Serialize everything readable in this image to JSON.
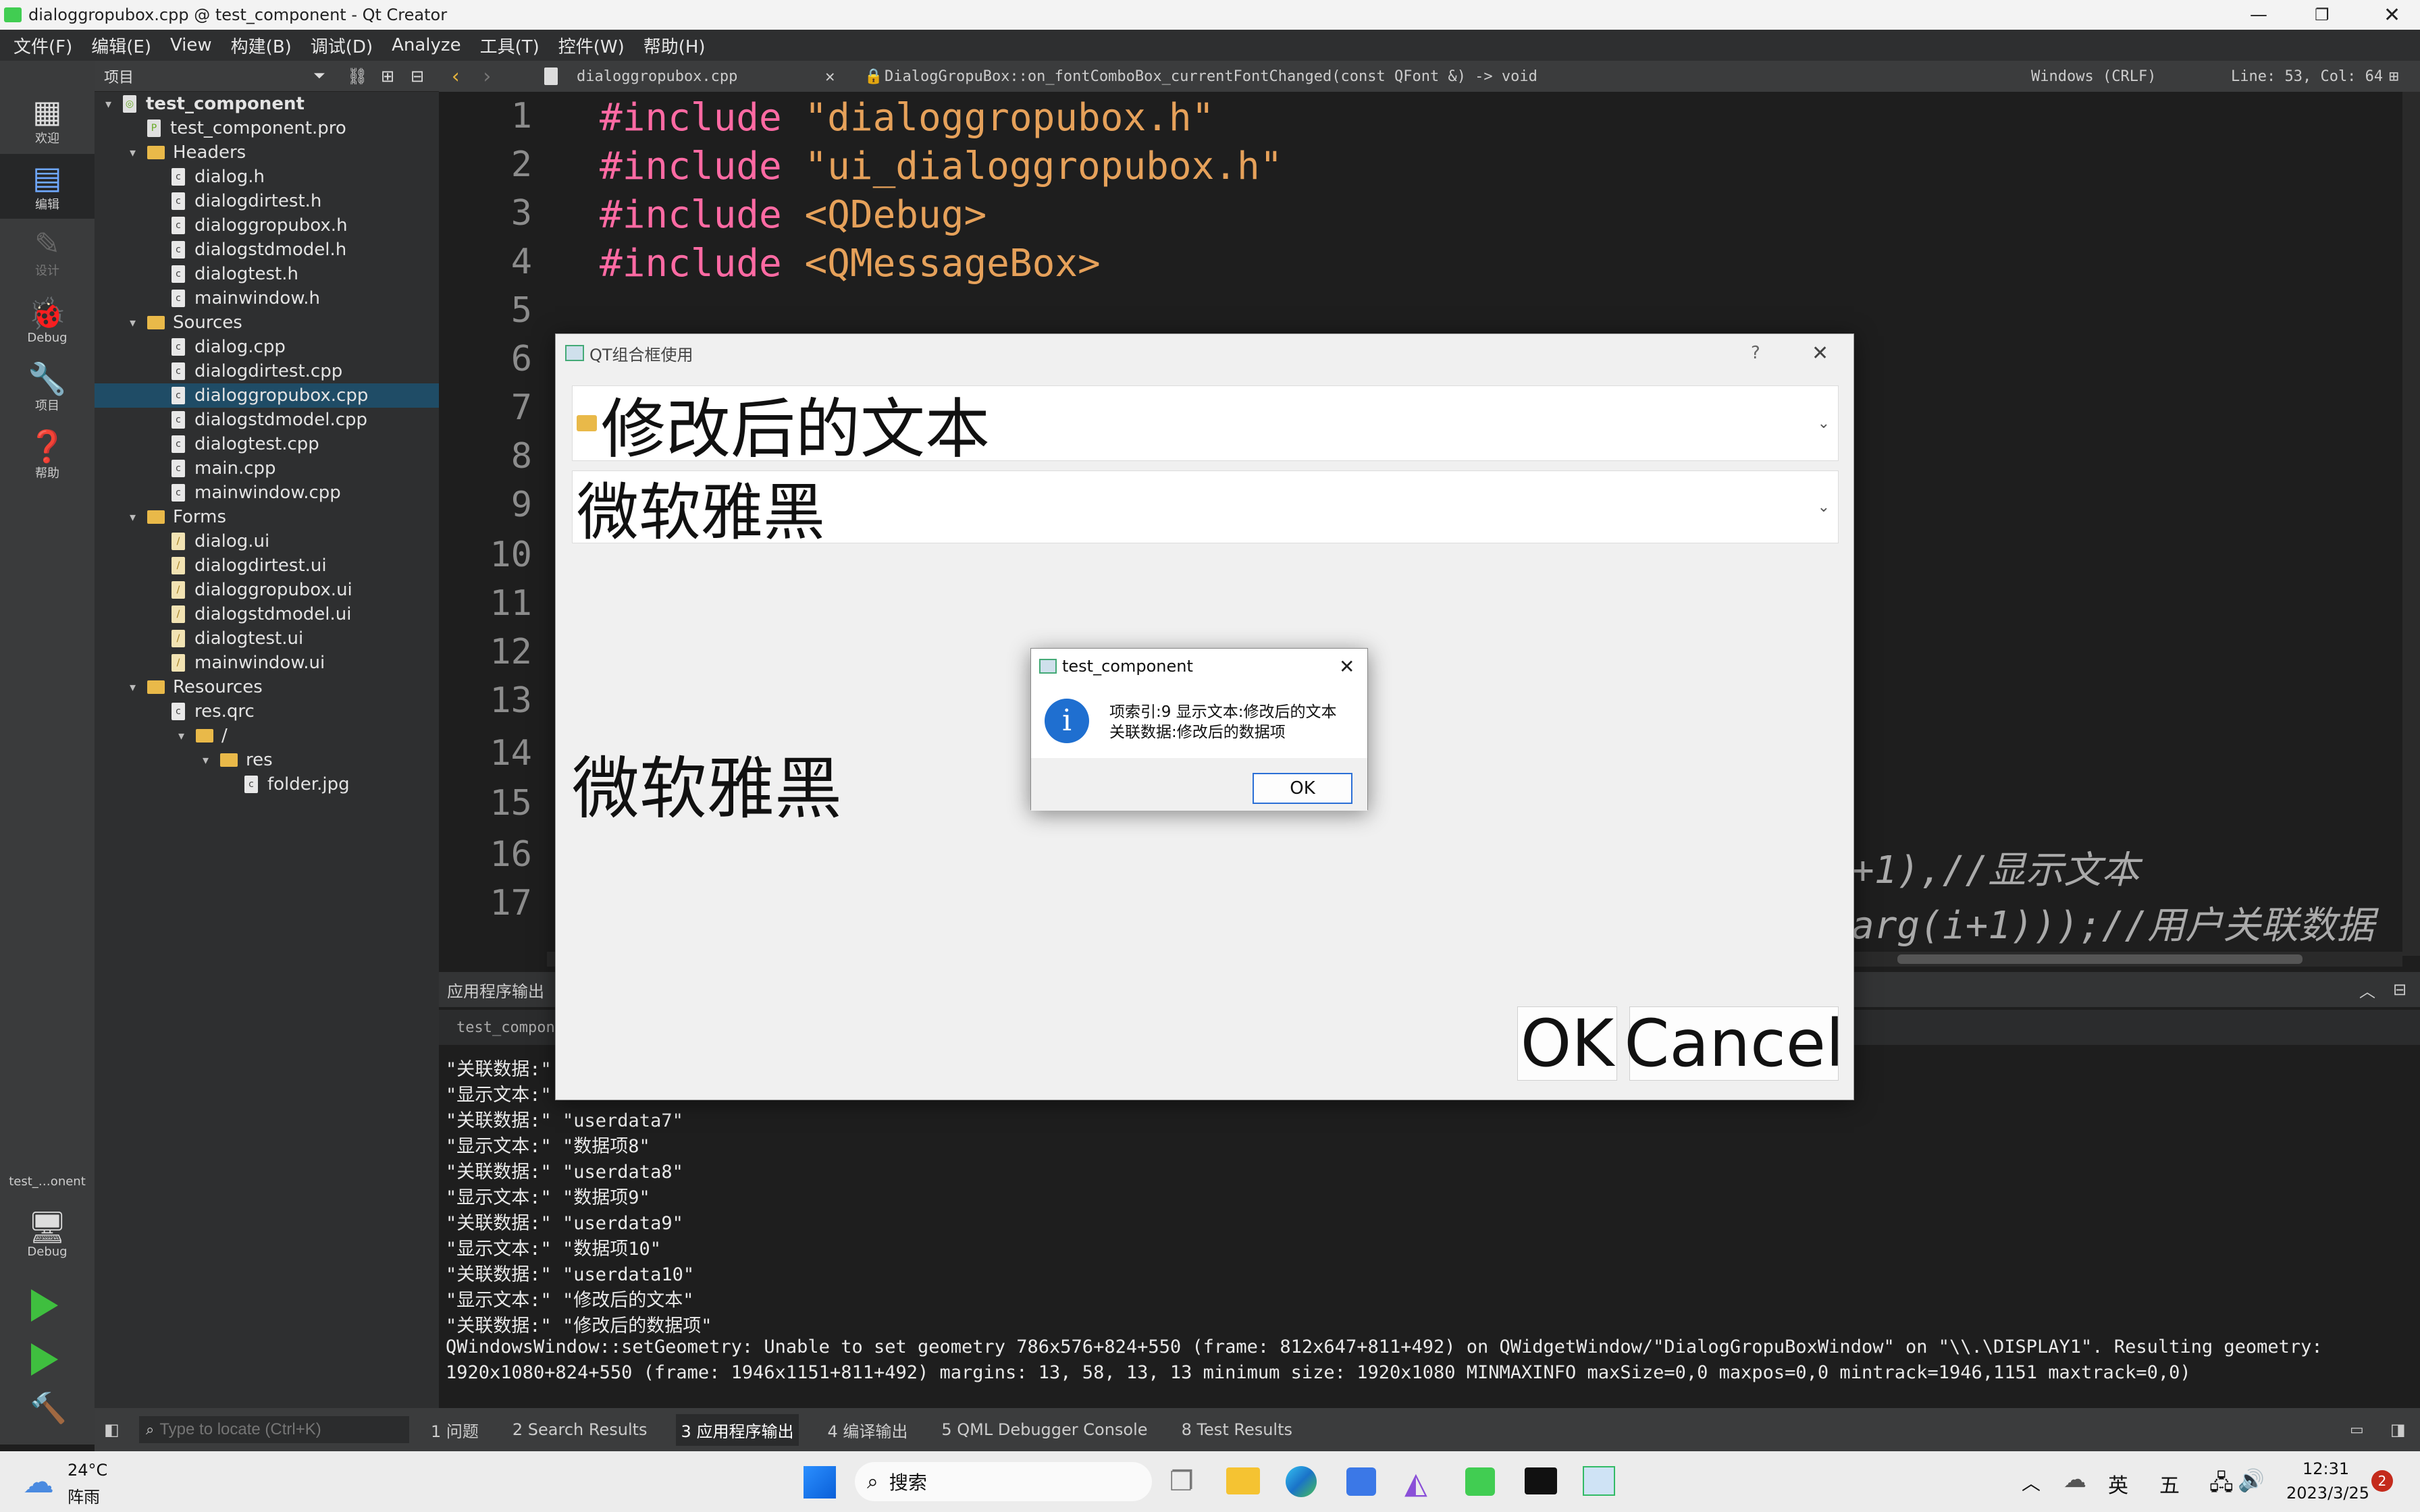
{
  "window": {
    "title": "dialoggropubox.cpp @ test_component - Qt Creator"
  },
  "menu": [
    "文件(F)",
    "编辑(E)",
    "View",
    "构建(B)",
    "调试(D)",
    "Analyze",
    "工具(T)",
    "控件(W)",
    "帮助(H)"
  ],
  "modes": [
    "欢迎",
    "编辑",
    "设计",
    "Debug",
    "项目",
    "帮助"
  ],
  "kit": {
    "project": "test_…onent",
    "mode": "Debug"
  },
  "project_panel": {
    "title": "项目"
  },
  "tree": [
    {
      "label": "test_component",
      "level": 0,
      "kind": "project"
    },
    {
      "label": "test_component.pro",
      "level": 1,
      "kind": "pro"
    },
    {
      "label": "Headers",
      "level": 1,
      "kind": "folder"
    },
    {
      "label": "dialog.h",
      "level": 2,
      "kind": "c"
    },
    {
      "label": "dialogdirtest.h",
      "level": 2,
      "kind": "c"
    },
    {
      "label": "dialoggropubox.h",
      "level": 2,
      "kind": "c"
    },
    {
      "label": "dialogstdmodel.h",
      "level": 2,
      "kind": "c"
    },
    {
      "label": "dialogtest.h",
      "level": 2,
      "kind": "c"
    },
    {
      "label": "mainwindow.h",
      "level": 2,
      "kind": "c"
    },
    {
      "label": "Sources",
      "level": 1,
      "kind": "folder"
    },
    {
      "label": "dialog.cpp",
      "level": 2,
      "kind": "c"
    },
    {
      "label": "dialogdirtest.cpp",
      "level": 2,
      "kind": "c"
    },
    {
      "label": "dialoggropubox.cpp",
      "level": 2,
      "kind": "c",
      "selected": true
    },
    {
      "label": "dialogstdmodel.cpp",
      "level": 2,
      "kind": "c"
    },
    {
      "label": "dialogtest.cpp",
      "level": 2,
      "kind": "c"
    },
    {
      "label": "main.cpp",
      "level": 2,
      "kind": "c"
    },
    {
      "label": "mainwindow.cpp",
      "level": 2,
      "kind": "c"
    },
    {
      "label": "Forms",
      "level": 1,
      "kind": "folder"
    },
    {
      "label": "dialog.ui",
      "level": 2,
      "kind": "ui"
    },
    {
      "label": "dialogdirtest.ui",
      "level": 2,
      "kind": "ui"
    },
    {
      "label": "dialoggropubox.ui",
      "level": 2,
      "kind": "ui"
    },
    {
      "label": "dialogstdmodel.ui",
      "level": 2,
      "kind": "ui"
    },
    {
      "label": "dialogtest.ui",
      "level": 2,
      "kind": "ui"
    },
    {
      "label": "mainwindow.ui",
      "level": 2,
      "kind": "ui"
    },
    {
      "label": "Resources",
      "level": 1,
      "kind": "folder"
    },
    {
      "label": "res.qrc",
      "level": 2,
      "kind": "c"
    },
    {
      "label": "/",
      "level": 3,
      "kind": "folder"
    },
    {
      "label": "res",
      "level": 4,
      "kind": "folder"
    },
    {
      "label": "folder.jpg",
      "level": 5,
      "kind": "c"
    }
  ],
  "editor": {
    "file": "dialoggropubox.cpp",
    "function": "DialogGropuBox::on_fontComboBox_currentFontChanged(const QFont &) -> void",
    "encoding": "Windows (CRLF)",
    "position": "Line: 53, Col: 64",
    "line_numbers": [
      "1",
      "2",
      "3",
      "4",
      "5",
      "6",
      "7",
      "8",
      "9",
      "10",
      "11",
      "12",
      "13",
      "14",
      "15",
      "16",
      "17"
    ],
    "includes": [
      {
        "kw": "#include",
        "file": "\"dialoggropubox.h\""
      },
      {
        "kw": "#include",
        "file": "\"ui_dialoggropubox.h\""
      },
      {
        "kw": "#include",
        "file": "<QDebug>"
      },
      {
        "kw": "#include",
        "file": "<QMessageBox>"
      }
    ],
    "partial_line_16": "+1),//显示文本",
    "partial_line_17": "arg(i+1)));//用户关联数据"
  },
  "output_panel": {
    "title": "应用程序输出",
    "tab": "test_compone…",
    "lines": [
      "\"关联数据:\"",
      "\"显示文本:\"",
      "\"关联数据:\" \"userdata7\"",
      "\"显示文本:\" \"数据项8\"",
      "\"关联数据:\" \"userdata8\"",
      "\"显示文本:\" \"数据项9\"",
      "\"关联数据:\" \"userdata9\"",
      "\"显示文本:\" \"数据项10\"",
      "\"关联数据:\" \"userdata10\"",
      "\"显示文本:\" \"修改后的文本\"",
      "\"关联数据:\" \"修改后的数据项\"",
      "QWindowsWindow::setGeometry: Unable to set geometry 786x576+824+550 (frame: 812x647+811+492) on QWidgetWindow/\"DialogGropuBoxWindow\" on \"\\\\.\\DISPLAY1\". Resulting geometry:",
      "1920x1080+824+550 (frame: 1946x1151+811+492) margins: 13, 58, 13, 13 minimum size: 1920x1080 MINMAXINFO maxSize=0,0 maxpos=0,0 mintrack=1946,1151 maxtrack=0,0)"
    ]
  },
  "statusbar": {
    "locator_placeholder": "Type to locate (Ctrl+K)",
    "tabs": [
      "1 问题",
      "2 Search Results",
      "3 应用程序输出",
      "4 编译输出",
      "5 QML Debugger Console",
      "8 Test Results"
    ]
  },
  "dialog": {
    "title": "QT组合框使用",
    "help": "?",
    "combo1": "修改后的文本",
    "combo2": "微软雅黑",
    "label": "微软雅黑",
    "ok": "OK",
    "cancel": "Cancel"
  },
  "messagebox": {
    "title": "test_component",
    "line1": "项索引:9 显示文本:修改后的文本",
    "line2": "关联数据:修改后的数据项",
    "ok": "OK"
  },
  "taskbar": {
    "temp": "24°C",
    "weather": "阵雨",
    "search": "搜索",
    "ime": "英",
    "weekday": "五",
    "time": "12:31",
    "date": "2023/3/25",
    "badge": "2"
  }
}
